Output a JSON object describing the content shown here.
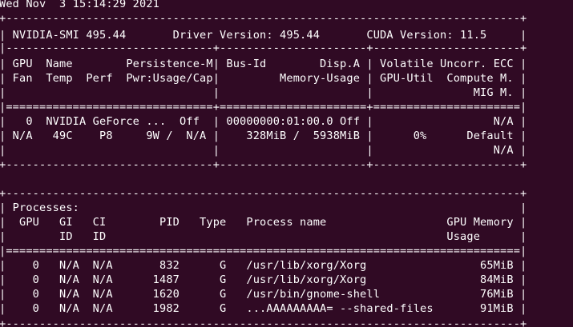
{
  "window": {
    "title": "nvidia-smi"
  },
  "colors": {
    "background": "#300a24",
    "text": "#ffffff"
  },
  "terminal": {
    "lines": [
      "Wed Nov  3 15:14:29 2021",
      "+-----------------------------------------------------------------------------+",
      "| NVIDIA-SMI 495.44       Driver Version: 495.44       CUDA Version: 11.5     |",
      "|-------------------------------+----------------------+----------------------+",
      "| GPU  Name        Persistence-M| Bus-Id        Disp.A | Volatile Uncorr. ECC |",
      "| Fan  Temp  Perf  Pwr:Usage/Cap|         Memory-Usage | GPU-Util  Compute M. |",
      "|                               |                      |               MIG M. |",
      "|===============================+======================+======================|",
      "|   0  NVIDIA GeForce ...  Off  | 00000000:01:00.0 Off |                  N/A |",
      "| N/A   49C    P8     9W /  N/A |    328MiB /  5938MiB |      0%      Default |",
      "|                               |                      |                  N/A |",
      "+-------------------------------+----------------------+----------------------+",
      "",
      "+-----------------------------------------------------------------------------+",
      "| Processes:                                                                  |",
      "|  GPU   GI   CI        PID   Type   Process name                  GPU Memory |",
      "|        ID   ID                                                   Usage      |",
      "|=============================================================================|",
      "|    0   N/A  N/A       832      G   /usr/lib/xorg/Xorg                 65MiB |",
      "|    0   N/A  N/A      1487      G   /usr/lib/xorg/Xorg                 84MiB |",
      "|    0   N/A  N/A      1620      G   /usr/bin/gnome-shell               76MiB |",
      "|    0   N/A  N/A      1982      G   ...AAAAAAAAA= --shared-files       91MiB |",
      "+-----------------------------------------------------------------------------+"
    ]
  }
}
